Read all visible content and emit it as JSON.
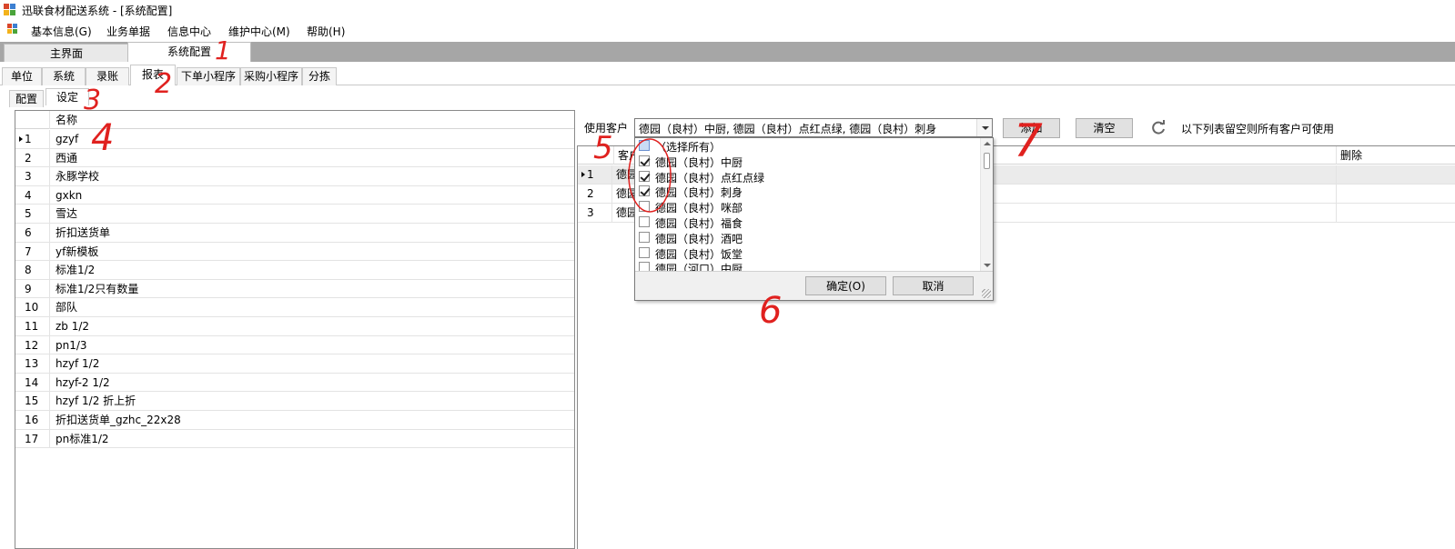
{
  "window": {
    "title": "迅联食材配送系统 - [系统配置]"
  },
  "menu": [
    "基本信息(G)",
    "业务单据",
    "信息中心",
    "维护中心(M)",
    "帮助(H)"
  ],
  "main_tabs": [
    "主界面",
    "系统配置"
  ],
  "sub_tabs": [
    "单位",
    "系统",
    "录账",
    "报表",
    "下单小程序",
    "采购小程序",
    "分拣"
  ],
  "third_tabs": [
    "配置",
    "设定"
  ],
  "left_grid": {
    "header": "名称",
    "rows": [
      {
        "idx": "1",
        "name": "gzyf"
      },
      {
        "idx": "2",
        "name": "西通"
      },
      {
        "idx": "3",
        "name": "永豚学校"
      },
      {
        "idx": "4",
        "name": "gxkn"
      },
      {
        "idx": "5",
        "name": "雪达"
      },
      {
        "idx": "6",
        "name": "折扣送货单"
      },
      {
        "idx": "7",
        "name": "yf新模板"
      },
      {
        "idx": "8",
        "name": "标准1/2"
      },
      {
        "idx": "9",
        "name": "标准1/2只有数量"
      },
      {
        "idx": "10",
        "name": "部队"
      },
      {
        "idx": "11",
        "name": "zb 1/2"
      },
      {
        "idx": "12",
        "name": "pn1/3"
      },
      {
        "idx": "13",
        "name": "hzyf 1/2"
      },
      {
        "idx": "14",
        "name": "hzyf-2 1/2"
      },
      {
        "idx": "15",
        "name": "hzyf 1/2 折上折"
      },
      {
        "idx": "16",
        "name": "折扣送货单_gzhc_22x28"
      },
      {
        "idx": "17",
        "name": "pn标准1/2"
      }
    ]
  },
  "customer": {
    "label": "使用客户",
    "value": "德园（良村）中厨, 德园（良村）点红点绿, 德园（良村）刺身",
    "add_label": "添加",
    "clear_label": "清空",
    "hint": "以下列表留空则所有客户可使用"
  },
  "right_grid": {
    "header_customer": "客户",
    "header_delete": "删除",
    "rows": [
      {
        "idx": "1",
        "customer": "德园"
      },
      {
        "idx": "2",
        "customer": "德园"
      },
      {
        "idx": "3",
        "customer": "德园"
      }
    ]
  },
  "dropdown": {
    "items": [
      {
        "label": "（选择所有）",
        "checked": false
      },
      {
        "label": "德园（良村）中厨",
        "checked": true
      },
      {
        "label": "德园（良村）点红点绿",
        "checked": true
      },
      {
        "label": "德园（良村）刺身",
        "checked": true
      },
      {
        "label": "德园（良村）咪部",
        "checked": false
      },
      {
        "label": "德园（良村）福食",
        "checked": false
      },
      {
        "label": "德园（良村）酒吧",
        "checked": false
      },
      {
        "label": "德园（良村）饭堂",
        "checked": false
      },
      {
        "label": "德园（河口）中厨",
        "checked": false
      }
    ],
    "ok_label": "确定(O)",
    "cancel_label": "取消"
  },
  "annotations": [
    "1",
    "2",
    "3",
    "4",
    "5",
    "6",
    "7"
  ]
}
